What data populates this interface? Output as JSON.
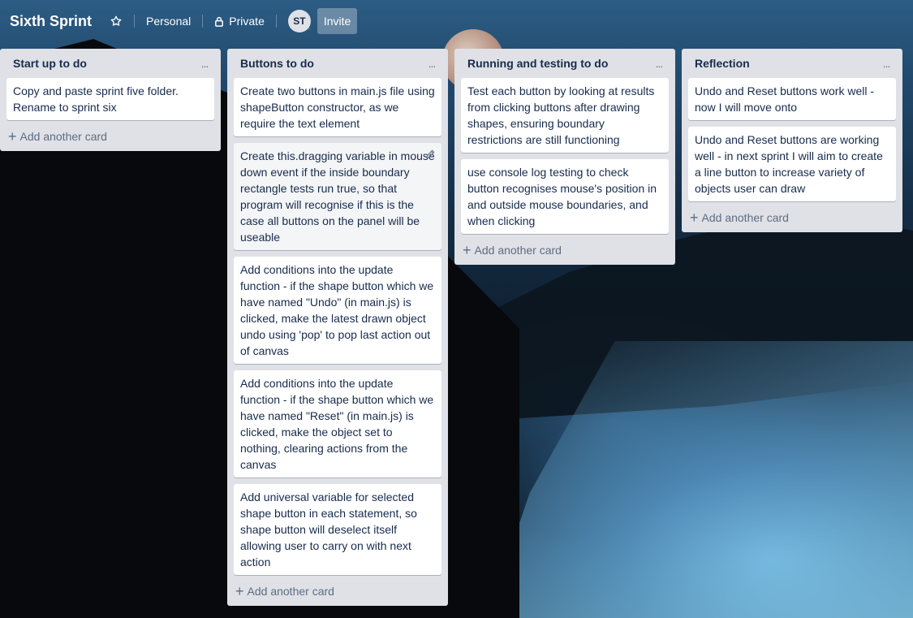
{
  "board": {
    "title": "Sixth Sprint",
    "team_label": "Personal",
    "visibility_label": "Private",
    "member_initials": "ST",
    "invite_label": "Invite"
  },
  "icons": {
    "star": "star-icon",
    "lock": "lock-icon",
    "list_menu": "more-horizontal-icon",
    "add": "plus-icon",
    "edit": "pencil-icon"
  },
  "colors": {
    "list_bg": "#dfe1e6",
    "card_bg": "#ffffff",
    "title_text": "#172b4d",
    "muted_text": "#5e6c84"
  },
  "lists": [
    {
      "title": "Start up to do",
      "menu": "...",
      "add_label": "Add another card",
      "cards": [
        "Copy and paste sprint five folder. Rename to sprint six"
      ]
    },
    {
      "title": "Buttons to do",
      "menu": "...",
      "add_label": "Add another card",
      "cards": [
        "Create two buttons in main.js file using shapeButton constructor, as we require the text element",
        "Create this.dragging variable in mouse down event if the inside boundary rectangle tests run true, so that program will recognise if this is the case all buttons on the panel will be useable",
        "Add conditions into the update function - if the shape button which we have named \"Undo\" (in main.js) is clicked, make the latest drawn object undo using 'pop' to pop last action out of canvas",
        "Add conditions into the update function - if the shape button which we have named \"Reset\" (in main.js) is clicked, make the object set to nothing, clearing actions from the canvas",
        "Add universal variable for selected shape button in each statement, so shape button will deselect itself allowing user to carry on with next action"
      ]
    },
    {
      "title": "Running and testing to do",
      "menu": "...",
      "add_label": "Add another card",
      "cards": [
        "Test each button by looking at results from clicking buttons after drawing shapes, ensuring boundary restrictions are still functioning",
        "use console log testing to check button recognises mouse's position in and outside mouse boundaries, and when clicking"
      ]
    },
    {
      "title": "Reflection",
      "menu": "...",
      "add_label": "Add another card",
      "cards": [
        "Undo and Reset buttons work well - now I will move onto",
        "Undo and Reset buttons are working well - in next sprint I will aim to create a line button to increase variety of objects user can draw"
      ]
    }
  ]
}
